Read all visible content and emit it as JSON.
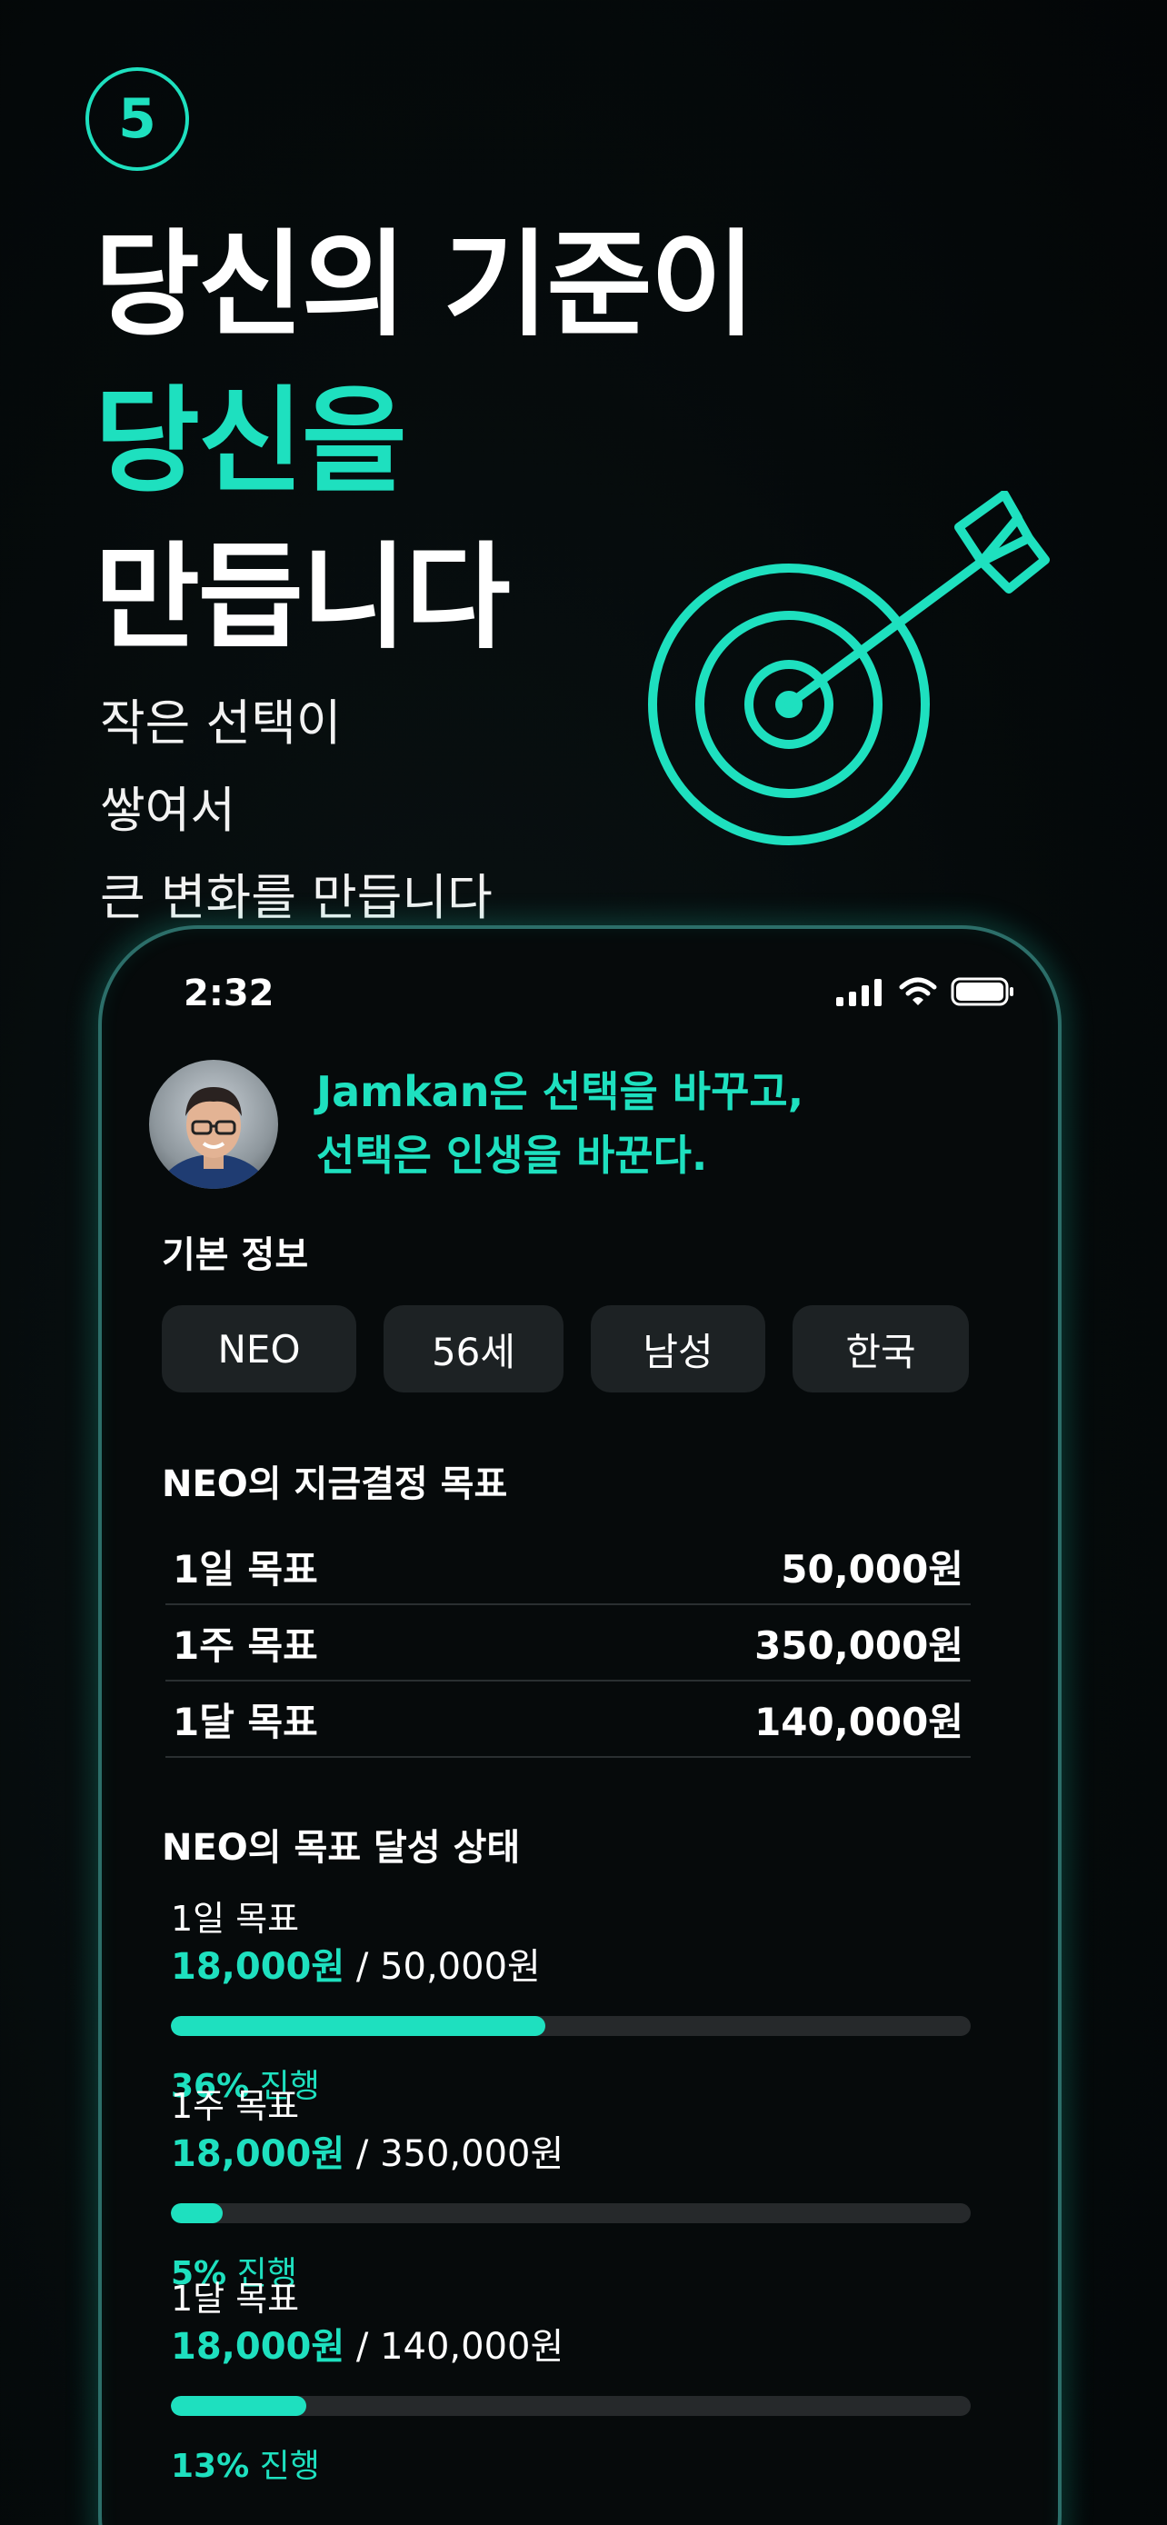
{
  "step": "5",
  "headline": {
    "line1": "당신의 기준이",
    "line2": "당신을",
    "line3": "만듭니다"
  },
  "subtitle": [
    "작은 선택이",
    "쌓여서",
    "큰 변화를 만듭니다"
  ],
  "phone": {
    "status_time": "2:32",
    "quote": [
      "Jamkan은 선택을 바꾸고,",
      "선택은 인생을 바꾼다."
    ],
    "basic_info": {
      "title": "기본 정보",
      "chips": [
        "NEO",
        "56세",
        "남성",
        "한국"
      ]
    },
    "goals": {
      "title": "NEO의 지금결정 목표",
      "rows": [
        {
          "label": "1일 목표",
          "value": "50,000원"
        },
        {
          "label": "1주 목표",
          "value": "350,000원"
        },
        {
          "label": "1달 목표",
          "value": "140,000원"
        }
      ]
    },
    "progress": {
      "title": "NEO의 목표 달성 상태",
      "items": [
        {
          "label": "1일 목표",
          "current": "18,000원",
          "total": " / 50,000원",
          "percent": 36,
          "percent_text": "36%",
          "suffix": " 진행"
        },
        {
          "label": "1주 목표",
          "current": "18,000원",
          "total": " / 350,000원",
          "percent": 5,
          "percent_text": "5%",
          "suffix": " 진행"
        },
        {
          "label": "1달 목표",
          "current": "18,000원",
          "total": " / 140,000원",
          "percent": 13,
          "percent_text": "13%",
          "suffix": " 진행"
        }
      ]
    }
  },
  "colors": {
    "accent": "#1ee0bf",
    "background": "#050b0c",
    "chip": "#1d2224",
    "track": "#26292b"
  }
}
